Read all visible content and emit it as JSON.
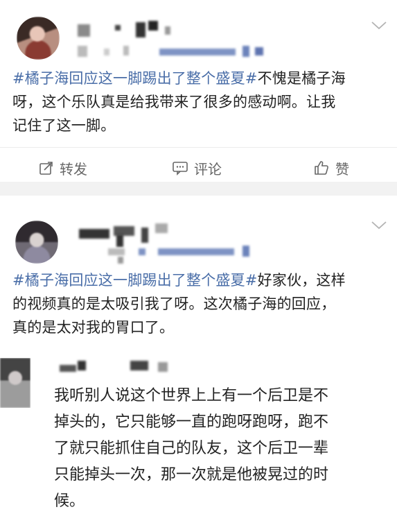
{
  "post1": {
    "hashtag": "#橘子海回应这一脚踢出了整个盛夏#",
    "text_after_hashtag": "不愧是橘子海",
    "line2": "呀，这个乐队真是给我带来了很多的感动啊。让我",
    "line3": "记住了这一脚。",
    "actions": {
      "repost_label": "转发",
      "comment_label": "评论",
      "like_label": "赞"
    }
  },
  "post2": {
    "hashtag": "#橘子海回应这一脚踢出了整个盛夏#",
    "text_after_hashtag": "好家伙，这样",
    "line2": "的视频真的是太吸引我了呀。这次橘子海的回应，",
    "line3": "真的是太对我的胃口了。"
  },
  "comment": {
    "lines": [
      "我听别人说这个世界上上有一个后卫是不",
      "掉头的，它只能够一直的跑呀跑呀，跑不",
      "了就只能抓住自己的队友，这个后卫一辈",
      "只能掉头一次，那一次就是他被晃过的时",
      "候。"
    ]
  },
  "colors": {
    "hashtag": "#4a6ea8",
    "text": "#222222",
    "secondary": "#666666",
    "separator": "#f2f2f2"
  },
  "icons": [
    "avatar",
    "chevron-down-icon",
    "repost-icon",
    "comment-icon",
    "like-icon"
  ]
}
